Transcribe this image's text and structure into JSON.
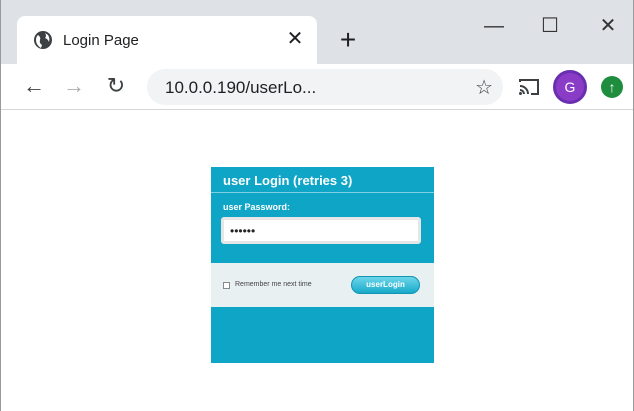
{
  "browser": {
    "tab": {
      "title": "Login Page",
      "close_glyph": "✕"
    },
    "new_tab_glyph": "+",
    "window_controls": {
      "minimize": "—",
      "maximize": "☐",
      "close": "✕"
    },
    "nav": {
      "back": "←",
      "forward": "→",
      "reload": "↻"
    },
    "url": "10.0.0.190/userLo...",
    "bookmark_glyph": "☆",
    "avatar_letter": "G",
    "update_glyph": "↑"
  },
  "login": {
    "title": "user Login (retries 3)",
    "password_label": "user Password:",
    "password_value": "••••••",
    "remember_label": "Remember me next time",
    "login_button": "userLogin"
  },
  "colors": {
    "panel": "#0ea5c6",
    "footer": "#e9f0f2",
    "avatar": "#8a3cc6",
    "update": "#1e8e3e"
  }
}
